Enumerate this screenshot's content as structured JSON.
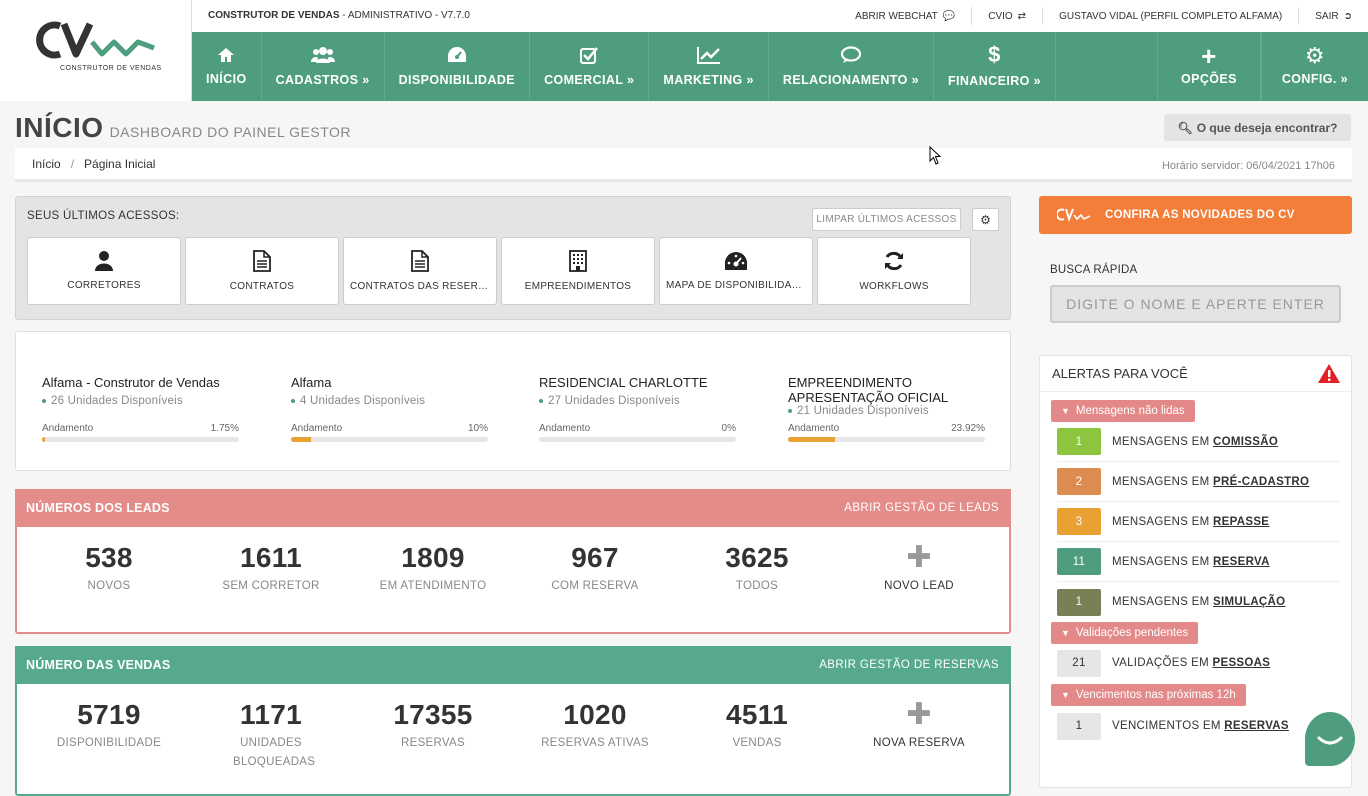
{
  "app": {
    "logo_sub": "CONSTRUTOR DE VENDAS",
    "brand_name": "CONSTRUTOR DE VENDAS",
    "brand_rest": " - ADMINISTRATIVO - V7.7.0"
  },
  "utility": {
    "webchat": "ABRIR WEBCHAT",
    "cvio": "CVIO",
    "user": "GUSTAVO VIDAL (PERFIL COMPLETO ALFAMA)",
    "logout": "SAIR"
  },
  "nav": {
    "items": [
      {
        "label": "INÍCIO",
        "icon": "home-icon"
      },
      {
        "label": "CADASTROS",
        "icon": "users-icon",
        "dropdown": true
      },
      {
        "label": "DISPONIBILIDADE",
        "icon": "dashboard-icon"
      },
      {
        "label": "COMERCIAL",
        "icon": "check-square-icon",
        "dropdown": true
      },
      {
        "label": "MARKETING",
        "icon": "line-chart-icon",
        "dropdown": true
      },
      {
        "label": "RELACIONAMENTO",
        "icon": "comments-icon",
        "dropdown": true
      },
      {
        "label": "FINANCEIRO",
        "icon": "dollar-icon",
        "dropdown": true
      }
    ],
    "opcoes": "OPÇÕES",
    "config": "CONFIG."
  },
  "page": {
    "title": "INÍCIO",
    "subtitle": "DASHBOARD DO PAINEL GESTOR",
    "search": "O que deseja encontrar?"
  },
  "breadcrumb": {
    "home": "Início",
    "current": "Página Inicial",
    "server_time": "Horário servidor: 06/04/2021 17h06"
  },
  "recent": {
    "label": "SEUS ÚLTIMOS ACESSOS:",
    "clear": "LIMPAR ÚLTIMOS ACESSOS",
    "tiles": [
      {
        "label": "CORRETORES",
        "icon": "user-icon"
      },
      {
        "label": "CONTRATOS",
        "icon": "file-icon"
      },
      {
        "label": "CONTRATOS DAS RESERVAS",
        "icon": "file-icon"
      },
      {
        "label": "EMPREENDIMENTOS",
        "icon": "building-icon"
      },
      {
        "label": "MAPA DE DISPONIBILIDADE",
        "icon": "dashboard-icon"
      },
      {
        "label": "WORKFLOWS",
        "icon": "refresh-icon"
      }
    ]
  },
  "empreendimentos": [
    {
      "name": "Alfama - Construtor de Vendas",
      "units": "26 Unidades Disponíveis",
      "progress_label": "Andamento",
      "progress": "1.75%",
      "progress_value": 1.75
    },
    {
      "name": "Alfama",
      "units": "4 Unidades Disponíveis",
      "progress_label": "Andamento",
      "progress": "10%",
      "progress_value": 10
    },
    {
      "name": "RESIDENCIAL CHARLOTTE",
      "units": "27 Unidades Disponíveis",
      "progress_label": "Andamento",
      "progress": "0%",
      "progress_value": 0
    },
    {
      "name": "EMPREENDIMENTO APRESENTAÇÃO OFICIAL",
      "units": "21 Unidades Disponíveis",
      "progress_label": "Andamento",
      "progress": "23.92%",
      "progress_value": 23.92
    }
  ],
  "leads": {
    "title": "NÚMEROS DOS LEADS",
    "link": "ABRIR GESTÃO DE LEADS",
    "color": "#e38c8a",
    "stats": [
      {
        "value": "538",
        "label": "NOVOS"
      },
      {
        "value": "1611",
        "label": "SEM CORRETOR"
      },
      {
        "value": "1809",
        "label": "EM ATENDIMENTO"
      },
      {
        "value": "967",
        "label": "COM RESERVA"
      },
      {
        "value": "3625",
        "label": "TODOS"
      }
    ],
    "add": "NOVO LEAD"
  },
  "vendas": {
    "title": "NÚMERO DAS VENDAS",
    "link": "ABRIR GESTÃO DE RESERVAS",
    "color": "#56a98b",
    "stats": [
      {
        "value": "5719",
        "label": "DISPONIBILIDADE"
      },
      {
        "value": "1171",
        "label": "UNIDADES BLOQUEADAS"
      },
      {
        "value": "17355",
        "label": "RESERVAS"
      },
      {
        "value": "1020",
        "label": "RESERVAS ATIVAS"
      },
      {
        "value": "4511",
        "label": "VENDAS"
      }
    ],
    "add": "NOVA RESERVA"
  },
  "news": {
    "label": "CONFIRA AS NOVIDADES DO CV"
  },
  "quick_search": {
    "label": "BUSCA RÁPIDA",
    "placeholder": "DIGITE O NOME E APERTE ENTER"
  },
  "alerts": {
    "title": "ALERTAS PARA VOCÊ",
    "groups": [
      {
        "label": "Mensagens não lidas",
        "rows": [
          {
            "count": "1",
            "prefix": "MENSAGENS EM ",
            "link": "COMISSÃO",
            "color": "#8cc63e"
          },
          {
            "count": "2",
            "prefix": "MENSAGENS EM ",
            "link": "PRÉ-CADASTRO",
            "color": "#dd8c4f"
          },
          {
            "count": "3",
            "prefix": "MENSAGENS EM ",
            "link": "REPASSE",
            "color": "#e9a133"
          },
          {
            "count": "11",
            "prefix": "MENSAGENS EM ",
            "link": "RESERVA",
            "color": "#4f9d7f"
          },
          {
            "count": "1",
            "prefix": "MENSAGENS EM ",
            "link": "SIMULAÇÃO",
            "color": "#7a7f55"
          }
        ]
      },
      {
        "label": "Validações pendentes",
        "rows": [
          {
            "count": "21",
            "prefix": "VALIDAÇÕES EM ",
            "link": "PESSOAS",
            "color": "#e6e6e6"
          }
        ]
      },
      {
        "label": "Vencimentos nas próximas 12h",
        "rows": [
          {
            "count": "1",
            "prefix": "VENCIMENTOS EM ",
            "link": "RESERVAS",
            "color": "#e6e6e6"
          }
        ]
      }
    ]
  }
}
